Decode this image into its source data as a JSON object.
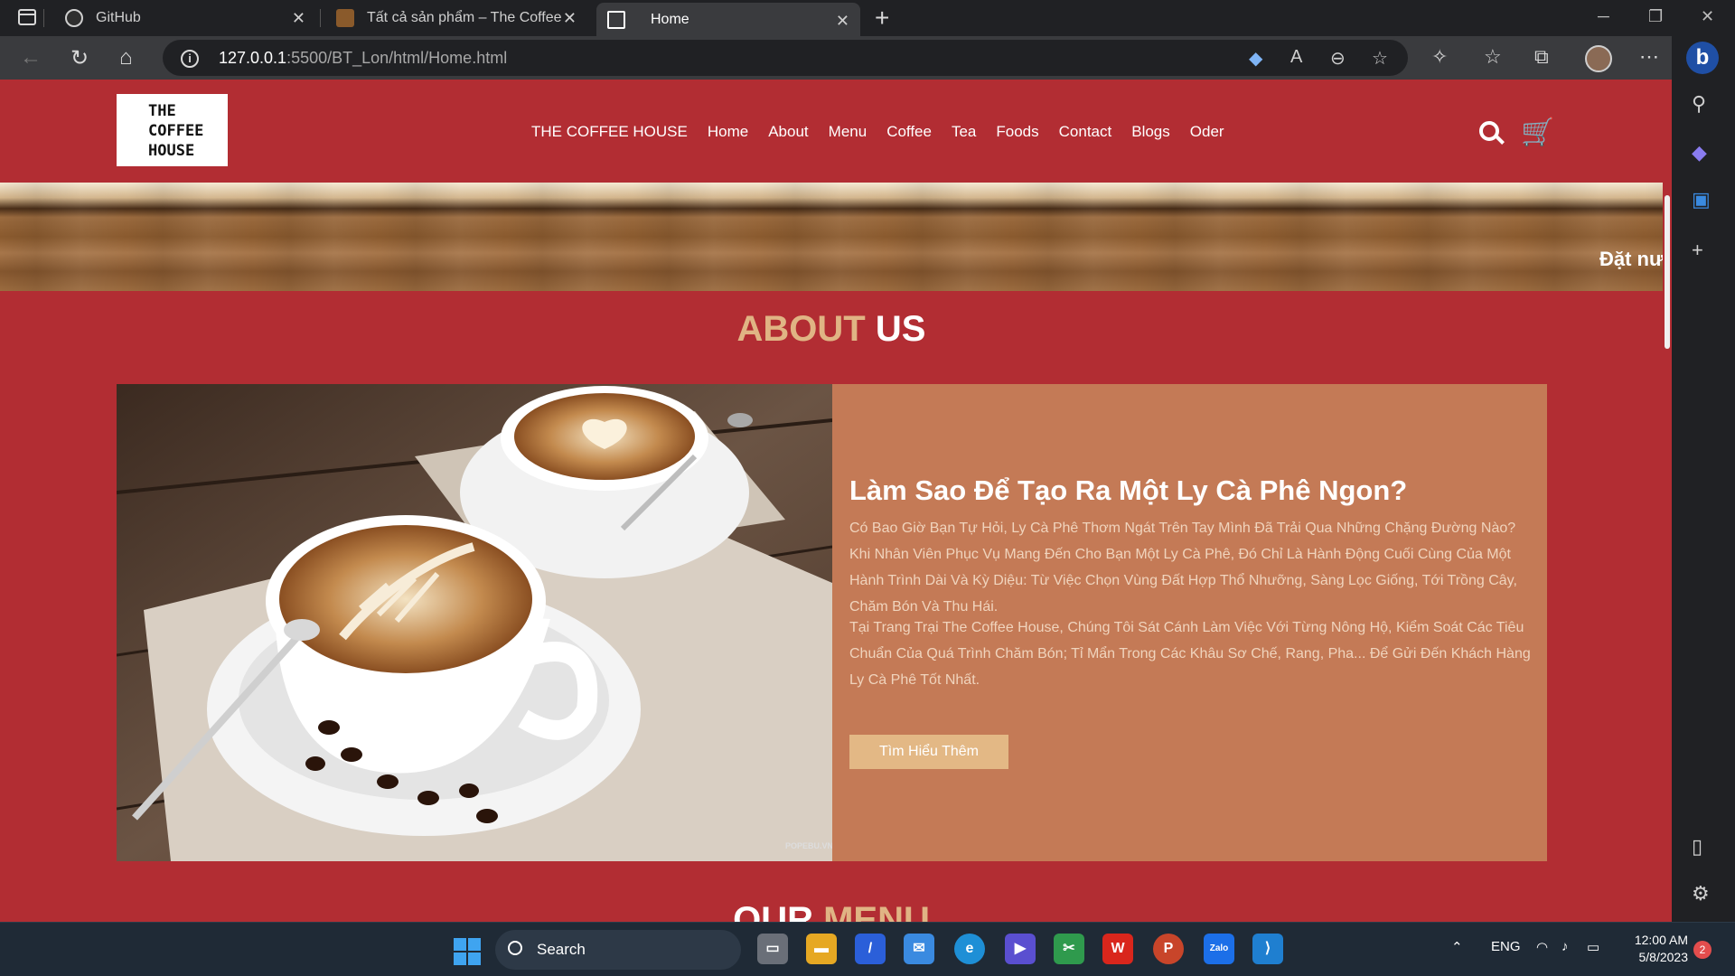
{
  "browser": {
    "tabs": [
      {
        "label": "GitHub",
        "icon": "github-icon"
      },
      {
        "label": "Tất cả sản phẩm – The Coffee House",
        "icon": "coffee-house-favicon"
      },
      {
        "label": "Home",
        "icon": "page-icon",
        "active": true
      }
    ],
    "url_host": "127.0.0.1",
    "url_rest": ":5500/BT_Lon/html/Home.html"
  },
  "site": {
    "logo_lines": [
      "THE",
      "COFFEE",
      "HOUSE"
    ],
    "nav": [
      "THE COFFEE HOUSE",
      "Home",
      "About",
      "Menu",
      "Coffee",
      "Tea",
      "Foods",
      "Contact",
      "Blogs",
      "Oder"
    ],
    "banner_text": "Đặt nư",
    "about_title_1": "ABOUT",
    "about_title_2": "US",
    "about_heading": "Làm Sao Để Tạo Ra Một Ly Cà Phê Ngon?",
    "about_p1": "Có Bao Giờ Bạn Tự Hỏi, Ly Cà Phê Thơm Ngát Trên Tay Mình Đã Trải Qua Những Chặng Đường Nào? Khi Nhân Viên Phục Vụ Mang Đến Cho Bạn Một Ly Cà Phê, Đó Chỉ Là Hành Động Cuối Cùng Của Một Hành Trình Dài Và Kỳ Diệu: Từ Việc Chọn Vùng Đất Hợp Thổ Nhưỡng, Sàng Lọc Giống, Tới Trồng Cây, Chăm Bón Và Thu Hái.",
    "about_p2": "Tại Trang Trại The Coffee House, Chúng Tôi Sát Cánh Làm Việc Với Từng Nông Hộ, Kiểm Soát Các Tiêu Chuẩn Của Quá Trình Chăm Bón; Tỉ Mẩn Trong Các Khâu Sơ Chế, Rang, Pha... Để Gửi Đến Khách Hàng Ly Cà Phê Tốt Nhất.",
    "learn_more": "Tìm Hiểu Thêm",
    "image_watermark": "POPEBU.VN",
    "menu_title_1": "OUR",
    "menu_title_2": "MENU"
  },
  "taskbar": {
    "search_label": "Search",
    "lang": "ENG",
    "time": "12:00 AM",
    "date": "5/8/2023",
    "notifications": "2"
  },
  "colors": {
    "page_bg": "#b22d33",
    "about_box": "#c47a56",
    "accent": "#e0b484",
    "button": "#e3b885"
  }
}
